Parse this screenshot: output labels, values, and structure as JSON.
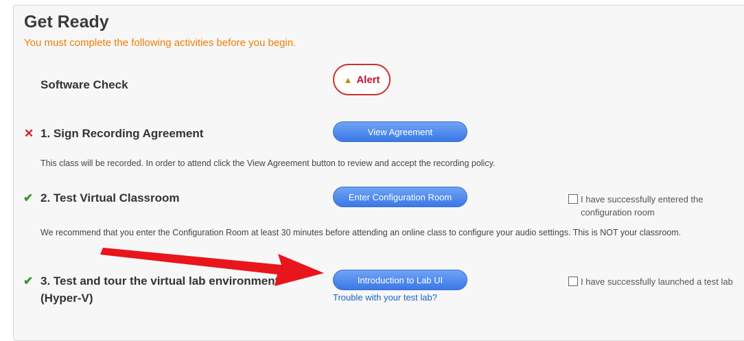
{
  "header": {
    "title": "Get Ready",
    "subtitle": "You must complete the following activities before you begin."
  },
  "software_check": {
    "label": "Software Check",
    "alert_label": "Alert",
    "alert_icon": "warning-icon"
  },
  "step1": {
    "status": "incomplete",
    "status_glyph": "✕",
    "label": "1. Sign Recording Agreement",
    "button": "View Agreement",
    "description": "This class will be recorded. In order to attend click the View Agreement button to review and accept the recording policy."
  },
  "step2": {
    "status": "complete",
    "status_glyph": "✔",
    "label": "2. Test Virtual Classroom",
    "button": "Enter Configuration Room",
    "checkbox_label": "I have successfully entered the configuration room",
    "description": "We recommend that you enter the Configuration Room at least 30 minutes before attending an online class to configure your audio settings. This is NOT your classroom."
  },
  "step3": {
    "status": "complete",
    "status_glyph": "✔",
    "label_line1": "3. Test and tour the virtual lab environment",
    "label_line2": "(Hyper-V)",
    "button": "Introduction to Lab UI",
    "link": "Trouble with your test lab?",
    "checkbox_label": "I have successfully launched a test lab"
  },
  "colors": {
    "accent_orange": "#f07d00",
    "button_blue": "#3a78e6",
    "error_red": "#d0211c",
    "success_green": "#2f9a2f",
    "annotation_arrow": "#e8161c"
  }
}
